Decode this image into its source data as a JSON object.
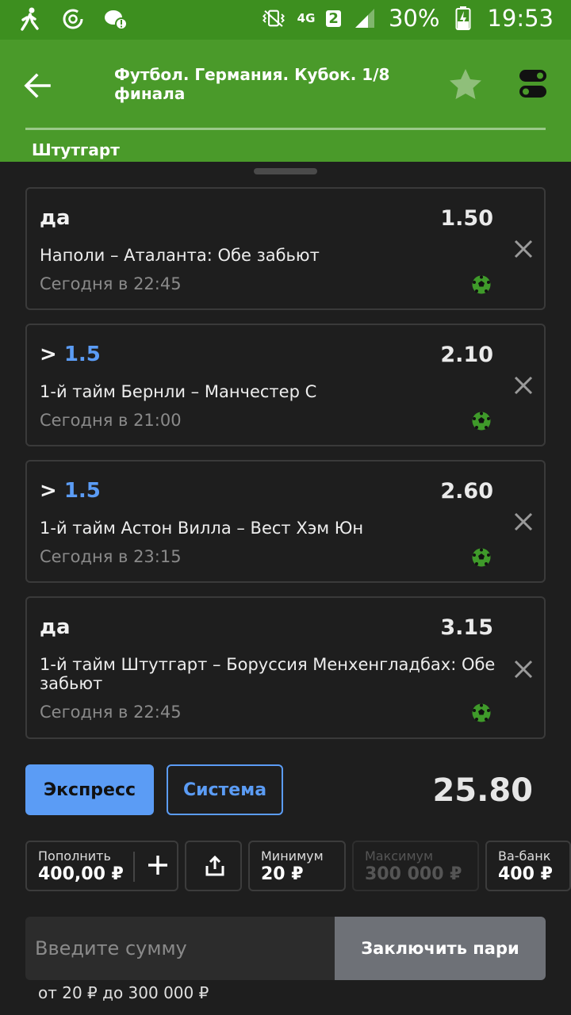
{
  "status_bar": {
    "network": "4G",
    "sim": "2",
    "battery": "30%",
    "time": "19:53",
    "icons": [
      "walk-icon",
      "sync-icon",
      "chat-alert-icon",
      "vibrate-icon",
      "signal-icon",
      "battery-charging-icon"
    ]
  },
  "header": {
    "title": "Футбол. Германия. Кубок. 1/8 финала",
    "subtitle": "Штутгарт"
  },
  "bets": [
    {
      "prefix": "",
      "outcome": "да",
      "odds": "1.50",
      "title": "Наполи – Аталанта: Обе забьют",
      "time": "Сегодня в 22:45",
      "sport_icon": "soccer-ball-icon"
    },
    {
      "prefix": "> ",
      "outcome": "1.5",
      "odds": "2.10",
      "title": "1-й тайм Бернли – Манчестер С",
      "time": "Сегодня в 21:00",
      "sport_icon": "soccer-ball-icon"
    },
    {
      "prefix": "> ",
      "outcome": "1.5",
      "odds": "2.60",
      "title": "1-й тайм Астон Вилла – Вест Хэм Юн",
      "time": "Сегодня в 23:15",
      "sport_icon": "soccer-ball-icon"
    },
    {
      "prefix": "",
      "outcome": "да",
      "odds": "3.15",
      "title": "1-й тайм Штутгарт – Боруссия Менхенгладбах: Обе забьют",
      "time": "Сегодня в 22:45",
      "sport_icon": "soccer-ball-icon"
    }
  ],
  "bet_type": {
    "express": "Экспресс",
    "system": "Система",
    "total_odds": "25.80"
  },
  "quick": {
    "deposit_label": "Пополнить",
    "deposit_value": "400,00 ₽",
    "min_label": "Минимум",
    "min_value": "20 ₽",
    "max_label": "Максимум",
    "max_value": "300 000 ₽",
    "allin_label": "Ва-банк",
    "allin_value": "400 ₽"
  },
  "stake": {
    "placeholder": "Введите сумму",
    "submit": "Заключить пари",
    "range_hint": "от 20 ₽ до 300 000 ₽"
  },
  "colors": {
    "brand_green": "#4a9a2a",
    "status_green": "#3d8f1f",
    "accent_blue": "#5b9cf5",
    "background": "#1e1e1e",
    "sport_green": "#3f9a2a"
  }
}
